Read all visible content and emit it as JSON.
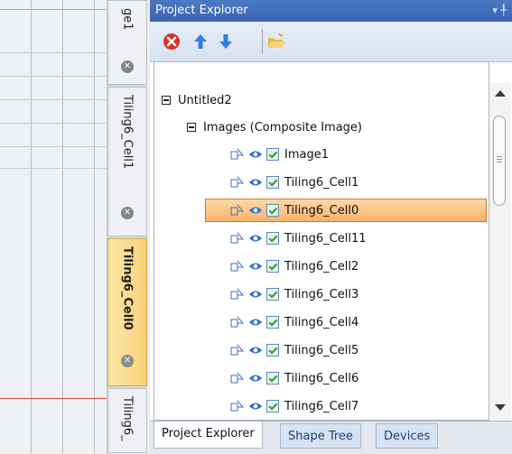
{
  "document_tabs": [
    {
      "label": "ge1",
      "active": false
    },
    {
      "label": "Tiling6_Cell1",
      "active": false
    },
    {
      "label": "Tiling6_Cell0",
      "active": true
    },
    {
      "label": "Tiling6_",
      "active": false
    }
  ],
  "panel": {
    "title": "Project Explorer",
    "toolbar": [
      "delete-icon",
      "move-up-icon",
      "move-down-icon",
      "open-folder-icon"
    ]
  },
  "tree": {
    "root": "Untitled2",
    "group": "Images (Composite Image)",
    "items": [
      "Image1",
      "Tiling6_Cell1",
      "Tiling6_Cell0",
      "Tiling6_Cell11",
      "Tiling6_Cell2",
      "Tiling6_Cell3",
      "Tiling6_Cell4",
      "Tiling6_Cell5",
      "Tiling6_Cell6",
      "Tiling6_Cell7"
    ],
    "selected": "Tiling6_Cell0"
  },
  "bottom_tabs": [
    "Project Explorer",
    "Shape Tree",
    "Devices"
  ],
  "colors": {
    "title_bar": "#3a65b0",
    "selection": "#f7b36a",
    "active_tab": "#f7d27a"
  }
}
